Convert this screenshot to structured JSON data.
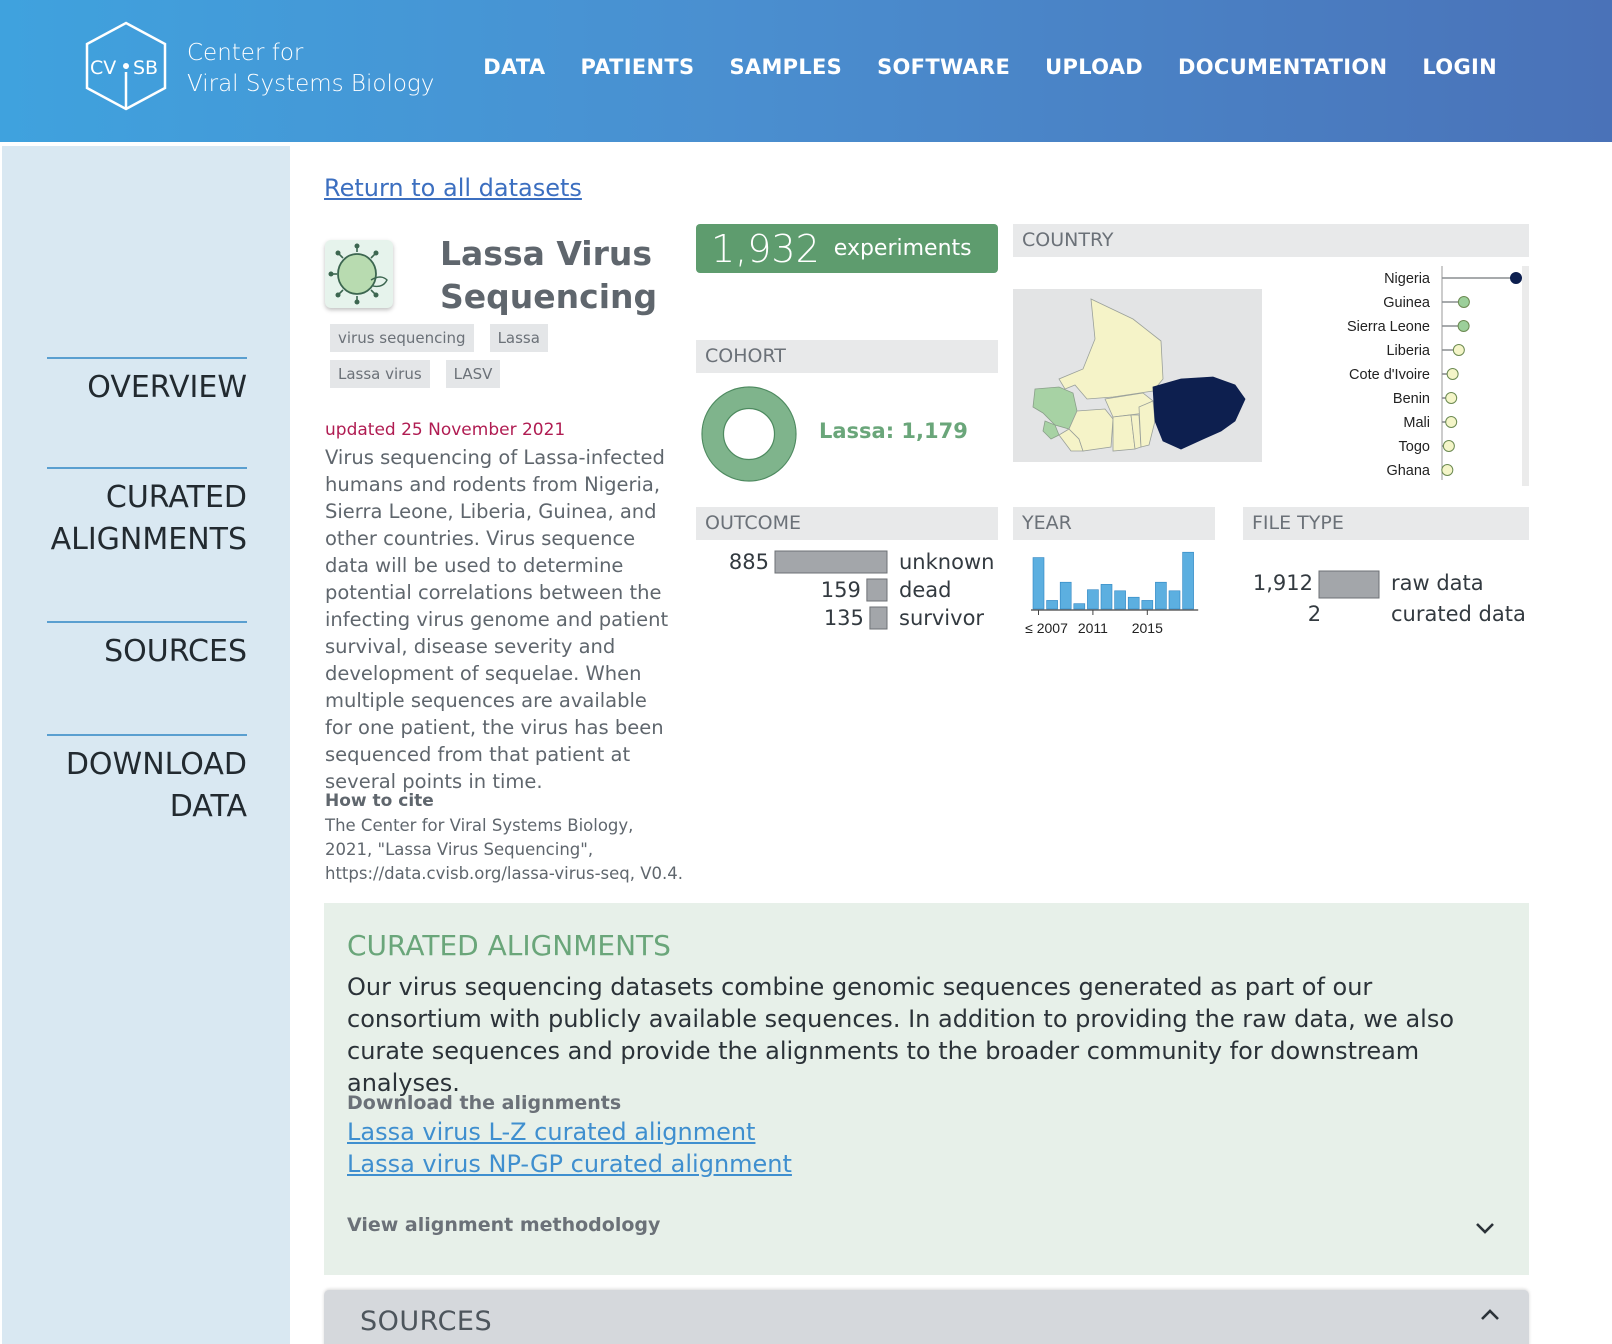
{
  "header": {
    "logo_text_left": "CV",
    "logo_text_right": "SB",
    "brand_line1": "Center for",
    "brand_line2": "Viral Systems Biology",
    "nav": [
      "DATA",
      "PATIENTS",
      "SAMPLES",
      "SOFTWARE",
      "UPLOAD",
      "DOCUMENTATION",
      "LOGIN"
    ]
  },
  "sidebar": {
    "items": [
      {
        "label_lines": [
          "OVERVIEW"
        ]
      },
      {
        "label_lines": [
          "CURATED",
          "ALIGNMENTS"
        ]
      },
      {
        "label_lines": [
          "SOURCES"
        ]
      },
      {
        "label_lines": [
          "DOWNLOAD",
          "DATA"
        ]
      }
    ]
  },
  "dataset": {
    "back_link": "Return to all datasets",
    "title_line1": "Lassa Virus",
    "title_line2": "Sequencing",
    "tags": [
      "virus sequencing",
      "Lassa",
      "Lassa virus",
      "LASV"
    ],
    "updated": "updated 25 November 2021",
    "description": "Virus sequencing of Lassa-infected humans and rodents from Nigeria, Sierra Leone, Liberia, Guinea, and other countries. Virus sequence data will be used to determine potential correlations between the infecting virus genome and patient survival, disease severity and development of sequelae. When multiple sequences are available for one patient, the virus has been sequenced from that patient at several points in time.",
    "cite_heading": "How to cite",
    "cite_text": "The Center for Viral Systems Biology, 2021, \"Lassa Virus Sequencing\", https://data.cvisb.org/lassa-virus-seq, V0.4."
  },
  "summary": {
    "experiments_count": "1,932",
    "experiments_label": "experiments",
    "cohort_heading": "COHORT",
    "cohort_label": "Lassa: 1,179",
    "outcome_heading": "OUTCOME",
    "year_heading": "YEAR",
    "file_heading": "FILE TYPE",
    "country_heading": "COUNTRY"
  },
  "chart_data": [
    {
      "type": "pie",
      "title": "COHORT",
      "categories": [
        "Lassa"
      ],
      "values": [
        1179
      ],
      "color": "#7fb48c"
    },
    {
      "type": "bar",
      "title": "OUTCOME",
      "categories": [
        "unknown",
        "dead",
        "survivor"
      ],
      "values": [
        885,
        159,
        135
      ],
      "value_labels": [
        "885",
        "159",
        "135"
      ],
      "color": "#a3a6aa"
    },
    {
      "type": "bar",
      "title": "YEAR",
      "tick_labels": [
        "≤ 2007",
        "2011",
        "2015"
      ],
      "values": [
        480,
        80,
        250,
        50,
        180,
        230,
        170,
        110,
        80,
        250,
        170,
        530
      ],
      "ylim": [
        0,
        560
      ],
      "color": "#5cafe0"
    },
    {
      "type": "bar",
      "title": "FILE TYPE",
      "categories": [
        "raw data",
        "curated data"
      ],
      "values": [
        1912,
        2
      ],
      "value_labels": [
        "1,912",
        "2"
      ],
      "color": "#a3a6aa"
    },
    {
      "type": "scatter",
      "title": "COUNTRY",
      "categories": [
        "Nigeria",
        "Guinea",
        "Sierra Leone",
        "Liberia",
        "Cote d'Ivoire",
        "Benin",
        "Mali",
        "Togo",
        "Ghana"
      ],
      "values": [
        1040,
        300,
        280,
        80,
        15,
        10,
        10,
        5,
        3
      ],
      "colors": [
        "#0d1f4f",
        "#9ccf9a",
        "#9ccf9a",
        "#f4f5c8",
        "#f4f5c8",
        "#f4f5c8",
        "#f4f5c8",
        "#f4f5c8",
        "#f4f5c8"
      ]
    }
  ],
  "curated": {
    "title": "CURATED ALIGNMENTS",
    "text": "Our virus sequencing datasets combine genomic sequences generated as part of our consortium with publicly available sequences. In addition to providing the raw data, we also curate sequences and provide the alignments to the broader community for downstream analyses.",
    "download_heading": "Download the alignments",
    "links": [
      "Lassa virus L-Z curated alignment",
      "Lassa virus NP-GP curated alignment"
    ],
    "methodology": "View alignment methodology"
  },
  "sources": {
    "title": "SOURCES"
  }
}
